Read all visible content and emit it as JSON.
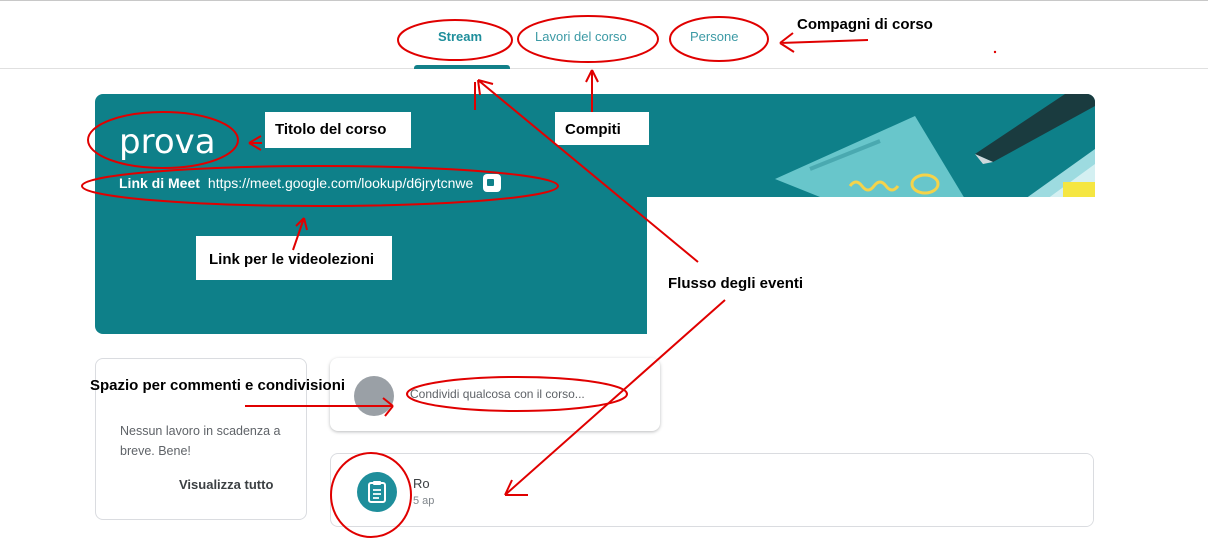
{
  "nav": {
    "tabs": [
      {
        "label": "Stream"
      },
      {
        "label": "Lavori del corso"
      },
      {
        "label": "Persone"
      }
    ]
  },
  "banner": {
    "course_title": "prova",
    "meet_label": "Link di Meet",
    "meet_url": "https://meet.google.com/lookup/d6jrytcnwe"
  },
  "upcoming": {
    "text": "Nessun lavoro in scadenza a breve. Bene!",
    "see_all": "Visualizza tutto"
  },
  "share": {
    "placeholder": "Condividi qualcosa con il corso..."
  },
  "stream_item": {
    "title": "Ro",
    "date": "5 ap"
  },
  "annotations": {
    "compagni": "Compagni di corso",
    "titolo": "Titolo del corso",
    "compiti": "Compiti",
    "link_video": "Link per le videolezioni",
    "flusso": "Flusso degli eventi",
    "spazio": "Spazio per commenti e condivisioni"
  },
  "colors": {
    "accent": "#1e8e9b",
    "banner": "#0e8089",
    "annotation_red": "#e00000"
  }
}
